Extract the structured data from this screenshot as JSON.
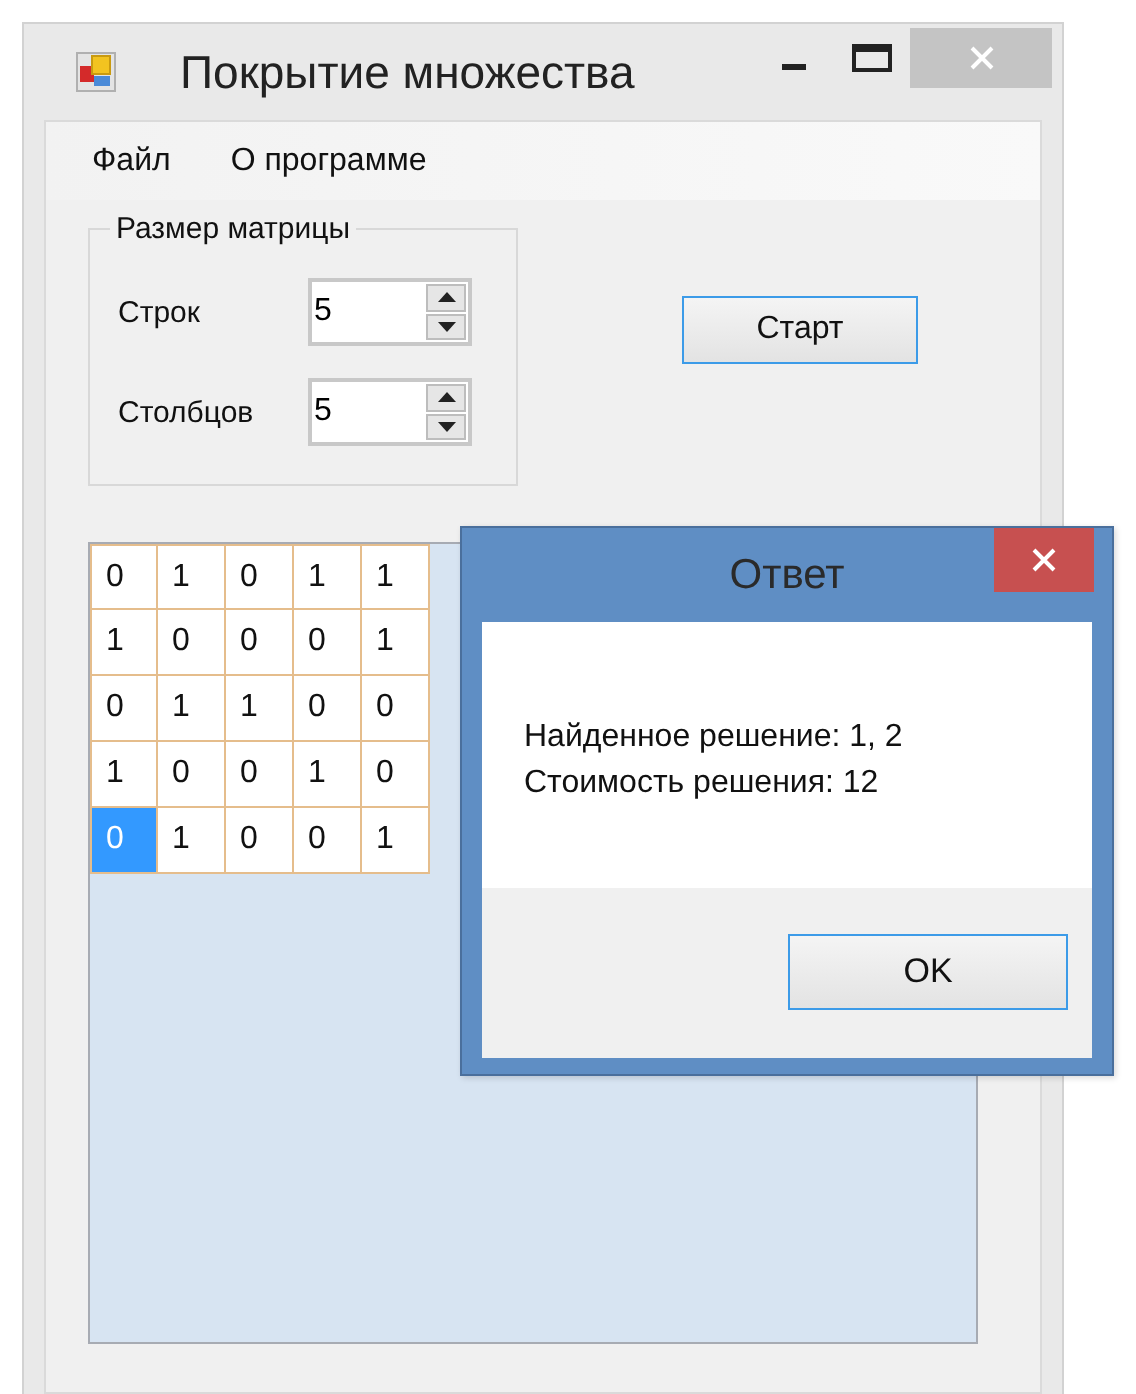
{
  "window": {
    "title": "Покрытие множества"
  },
  "menu": [
    {
      "label": "Файл"
    },
    {
      "label": "О программе"
    }
  ],
  "size_group": {
    "title": "Размер матрицы",
    "fields": [
      {
        "label": "Строк",
        "value": "5"
      },
      {
        "label": "Столбцов",
        "value": "5"
      }
    ]
  },
  "start_button": "Старт",
  "matrix": [
    [
      {
        "value": "0",
        "selected": false
      },
      {
        "value": "1",
        "selected": false
      },
      {
        "value": "0",
        "selected": false
      },
      {
        "value": "1",
        "selected": false
      },
      {
        "value": "1",
        "selected": false
      }
    ],
    [
      {
        "value": "1",
        "selected": false
      },
      {
        "value": "0",
        "selected": false
      },
      {
        "value": "0",
        "selected": false
      },
      {
        "value": "0",
        "selected": false
      },
      {
        "value": "1",
        "selected": false
      }
    ],
    [
      {
        "value": "0",
        "selected": false
      },
      {
        "value": "1",
        "selected": false
      },
      {
        "value": "1",
        "selected": false
      },
      {
        "value": "0",
        "selected": false
      },
      {
        "value": "0",
        "selected": false
      }
    ],
    [
      {
        "value": "1",
        "selected": false
      },
      {
        "value": "0",
        "selected": false
      },
      {
        "value": "0",
        "selected": false
      },
      {
        "value": "1",
        "selected": false
      },
      {
        "value": "0",
        "selected": false
      }
    ],
    [
      {
        "value": "0",
        "selected": true
      },
      {
        "value": "1",
        "selected": false
      },
      {
        "value": "0",
        "selected": false
      },
      {
        "value": "0",
        "selected": false
      },
      {
        "value": "1",
        "selected": false
      }
    ]
  ],
  "dialog": {
    "title": "Ответ",
    "lines": [
      "Найденное решение: 1, 2",
      "Стоимость решения: 12"
    ],
    "ok_button": "OK"
  }
}
